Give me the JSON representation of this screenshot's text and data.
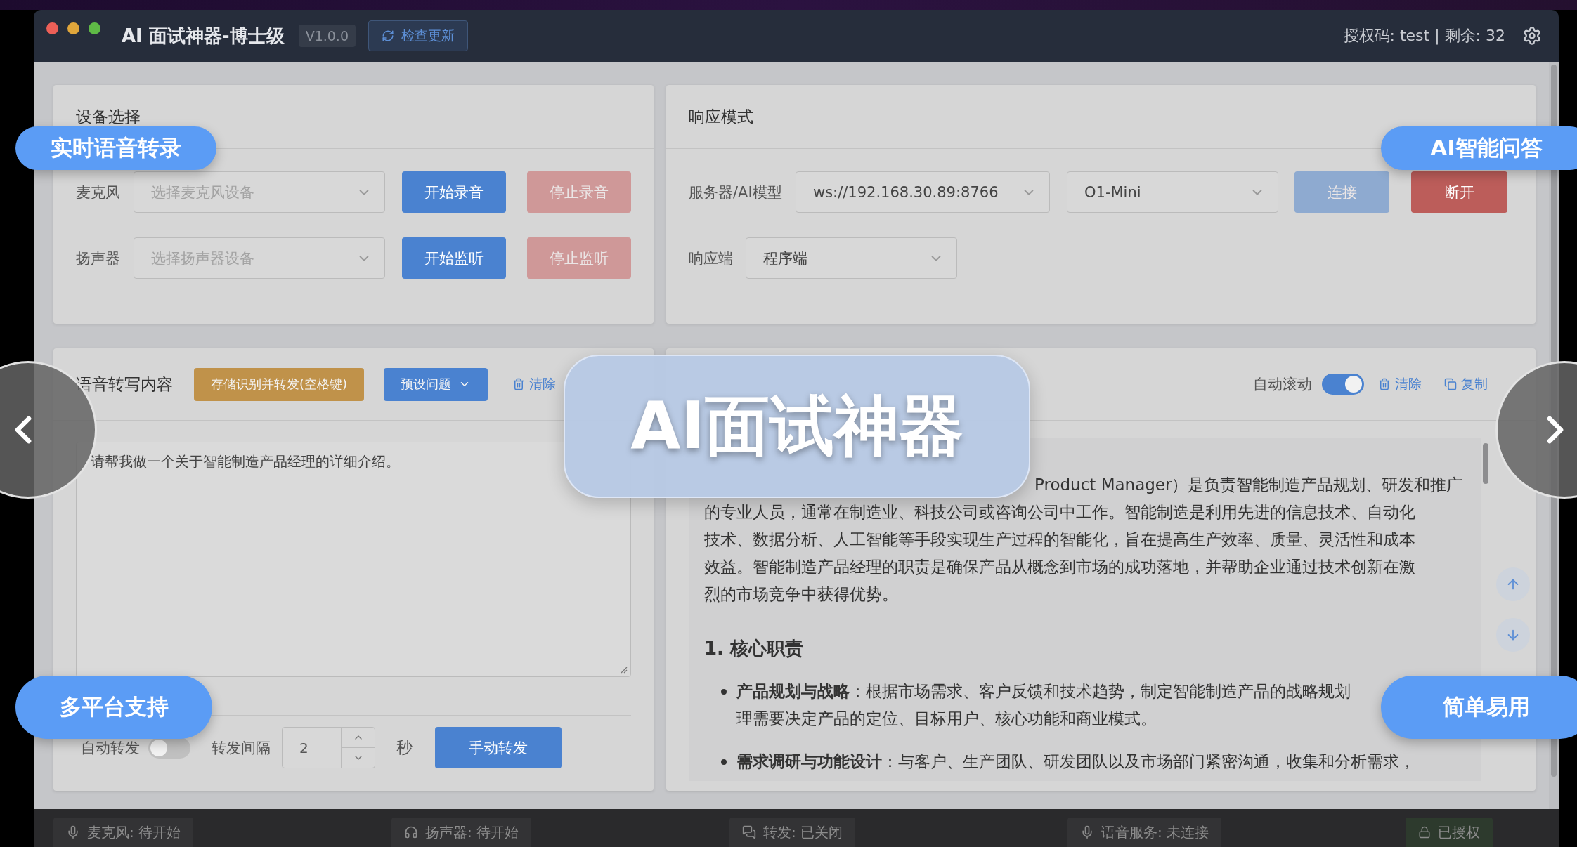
{
  "title_bar": {
    "title": "AI 面试神器-博士级",
    "version": "V1.0.0",
    "update_button": "检查更新",
    "license": "授权码: test | 剩余: 32"
  },
  "device_panel": {
    "title": "设备选择",
    "rows": [
      {
        "label": "麦克风",
        "placeholder": "选择麦克风设备",
        "start": "开始录音",
        "stop": "停止录音",
        "stop_disabled": true
      },
      {
        "label": "扬声器",
        "placeholder": "选择扬声器设备",
        "start": "开始监听",
        "stop": "停止监听",
        "stop_disabled": true
      }
    ]
  },
  "response_panel": {
    "title": "响应模式",
    "server_label": "服务器/AI模型",
    "server": "ws://192.168.30.89:8766",
    "model": "O1-Mini",
    "connect": "连接",
    "connect_disabled": true,
    "disconnect": "断开",
    "responder_label": "响应端",
    "responder": "程序端"
  },
  "transcript_panel": {
    "title": "语音转写内容",
    "save_button": "存储识别并转发(空格键)",
    "preset_button": "预设问题",
    "clear_link": "清除",
    "text": "请帮我做一个关于智能制造产品经理的详细介绍。",
    "auto_forward_label": "自动转发",
    "auto_forward_on": false,
    "interval_label": "转发间隔",
    "interval": "2",
    "interval_unit": "秒",
    "manual_button": "手动转发"
  },
  "answer_panel": {
    "auto_scroll_label": "自动滚动",
    "auto_scroll_on": true,
    "clear_link": "清除",
    "copy_link": "复制",
    "paragraph_lines": [
      "Product Manager）是负责智能制造产品规划、研发和推广",
      "的专业人员，通常在制造业、科技公司或咨询公司中工作。智能制造是利用先进的信息技术、自动化",
      "技术、数据分析、人工智能等手段实现生产过程的智能化，旨在提高生产效率、质量、灵活性和成本",
      "效益。智能制造产品经理的职责是确保产品从概念到市场的成功落地，并帮助企业通过技术创新在激",
      "烈的市场竞争中获得优势。"
    ],
    "heading": "1. 核心职责",
    "bullets": [
      {
        "lines": [
          "**产品规划与战略**：根据市场需求、客户反馈和技术趋势，制定智能制造产品的战略规划",
          "理需要决定产品的定位、目标用户、核心功能和商业模式。"
        ]
      },
      {
        "lines": [
          "**需求调研与功能设计**：与客户、生产团队、研发团队以及市场部门紧密沟通，收集和分析需求，"
        ]
      }
    ]
  },
  "status_bar": [
    {
      "kind": "mic",
      "text": "麦克风: 待开始"
    },
    {
      "kind": "headphones",
      "text": "扬声器: 待开始"
    },
    {
      "kind": "chat",
      "text": "转发: 已关闭"
    },
    {
      "kind": "mic",
      "text": "语音服务: 未连接"
    },
    {
      "kind": "lock",
      "text": "已授权"
    }
  ],
  "overlays": {
    "badges": [
      "实时语音转录",
      "AI智能问答",
      "多平台支持",
      "简单易用"
    ],
    "banner": "AI面试神器"
  }
}
